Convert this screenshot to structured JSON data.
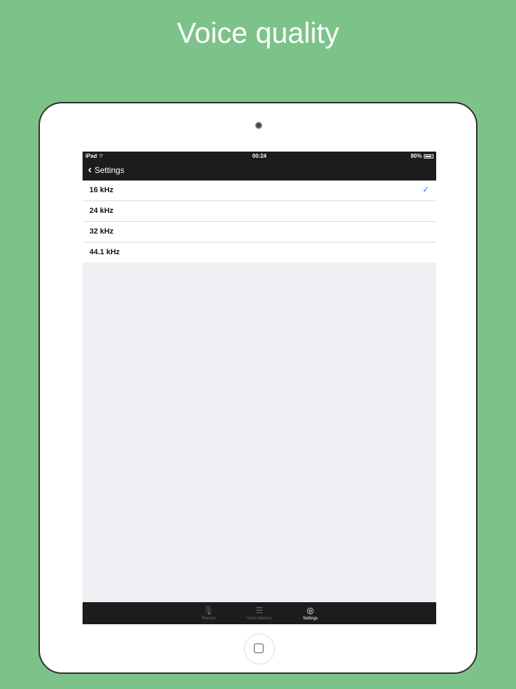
{
  "headline": "Voice quality",
  "status_bar": {
    "device": "iPad",
    "time": "00:24",
    "battery": "80%"
  },
  "nav": {
    "back_label": "Settings"
  },
  "quality_options": [
    {
      "label": "16 kHz",
      "selected": true
    },
    {
      "label": "24 kHz",
      "selected": false
    },
    {
      "label": "32 kHz",
      "selected": false
    },
    {
      "label": "44.1 kHz",
      "selected": false
    }
  ],
  "check_glyph": "✓",
  "tabs": [
    {
      "label": "Record",
      "icon": "microphone-icon",
      "glyph": "🎙",
      "active": false
    },
    {
      "label": "Voice Memos",
      "icon": "list-icon",
      "glyph": "☰",
      "active": false
    },
    {
      "label": "Settings",
      "icon": "gear-icon",
      "glyph": "◎",
      "active": true
    }
  ],
  "colors": {
    "background": "#7dc389",
    "bar": "#1c1c1c",
    "accent": "#1a7cf5"
  }
}
